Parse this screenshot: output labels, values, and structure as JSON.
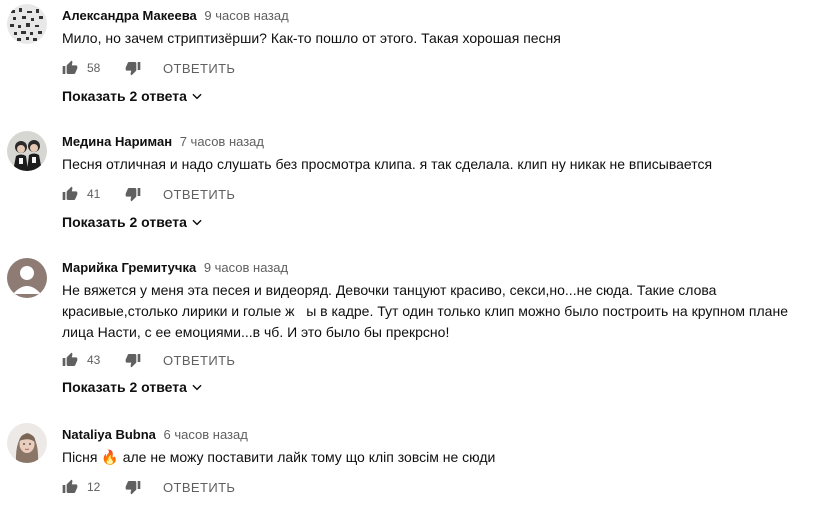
{
  "comments": [
    {
      "author": "Александра Макеева",
      "time": "9 часов назад",
      "text": "Мило, но зачем стриптизёрши? Как-то пошло от этого. Такая хорошая песня",
      "likes": "58",
      "reply_label": "ОТВЕТИТЬ",
      "show_replies": "Показать 2 ответа"
    },
    {
      "author": "Медина Нариман",
      "time": "7 часов назад",
      "text": "Песня отличная и надо слушать без просмотра клипа. я так сделала. клип ну никак не вписывается",
      "likes": "41",
      "reply_label": "ОТВЕТИТЬ",
      "show_replies": "Показать 2 ответа"
    },
    {
      "author": "Марийка Гремитучка",
      "time": "9 часов назад",
      "text": "Не вяжется у меня эта песея и видеоряд. Девочки танцуют красиво, секси,но...не сюда. Такие слова\nкрасивые,столько лирики и голые ж   ы в кадре. Тут один только клип можно было построить на крупном плане\nлица Насти, с ее емоциями...в чб. И это было бы прекрсно!",
      "likes": "43",
      "reply_label": "ОТВЕТИТЬ",
      "show_replies": "Показать 2 ответа"
    },
    {
      "author": "Nataliya Bubna",
      "time": "6 часов назад",
      "text_before": "Пісня ",
      "text_emoji": "🔥",
      "text_after": " але не можу поставити лайк тому що кліп зовсім не сюди",
      "likes": "12",
      "reply_label": "ОТВЕТИТЬ"
    }
  ]
}
